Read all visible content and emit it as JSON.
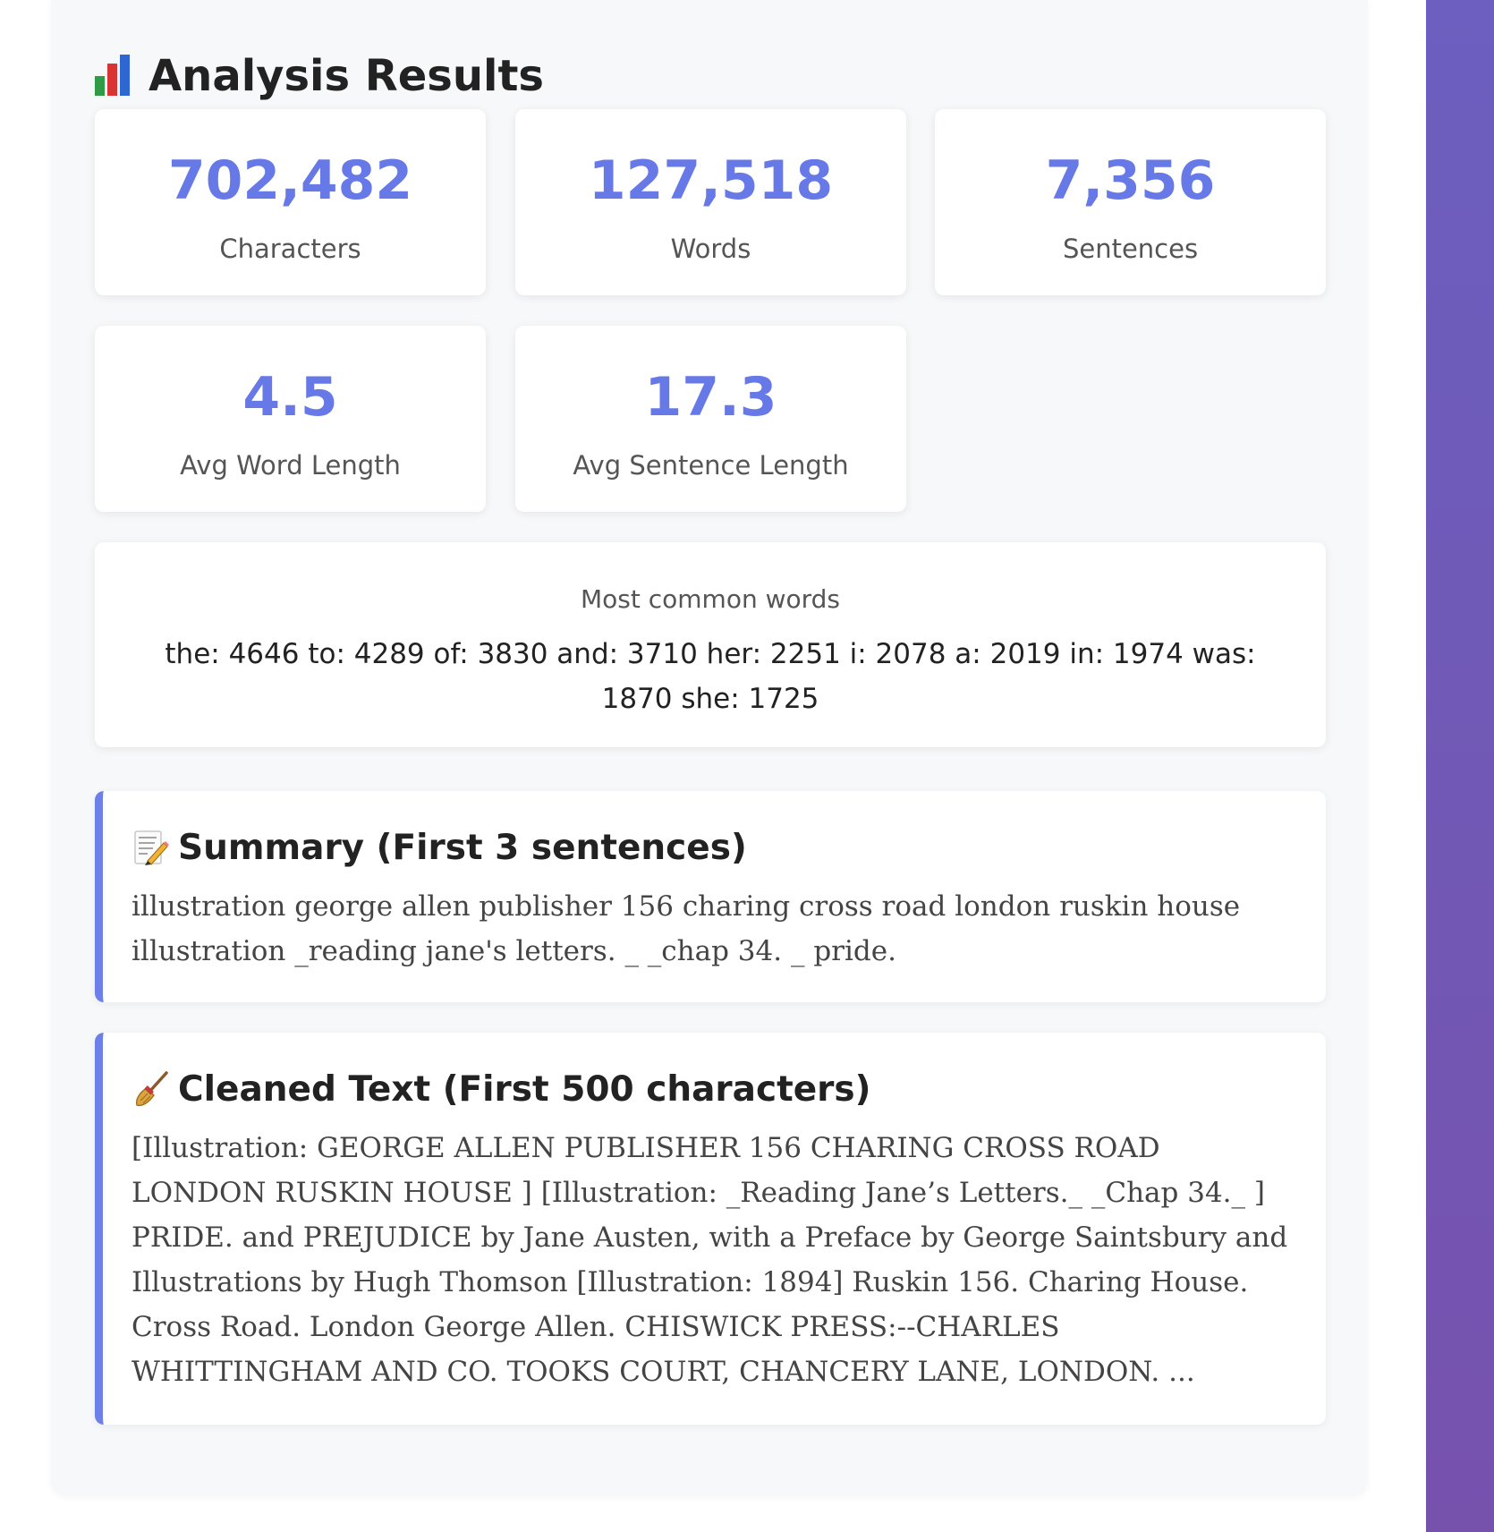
{
  "heading": {
    "icon": "bar-chart-icon",
    "title": "Analysis Results"
  },
  "stats": [
    {
      "value": "702,482",
      "label": "Characters"
    },
    {
      "value": "127,518",
      "label": "Words"
    },
    {
      "value": "7,356",
      "label": "Sentences"
    },
    {
      "value": "4.5",
      "label": "Avg Word Length"
    },
    {
      "value": "17.3",
      "label": "Avg Sentence Length"
    }
  ],
  "common_words": {
    "title": "Most common words",
    "text": "the: 4646 to: 4289 of: 3830 and: 3710 her: 2251 i: 2078 a: 2019 in: 1974 was: 1870 she: 1725"
  },
  "summary": {
    "icon": "memo-icon",
    "title": "Summary (First 3 sentences)",
    "text": "illustration george allen publisher 156 charing cross road london ruskin house illustration _reading jane's letters. _ _chap 34. _ pride."
  },
  "cleaned": {
    "icon": "broom-icon",
    "title": "Cleaned Text (First 500 characters)",
    "text": "[Illustration:  GEORGE ALLEN PUBLISHER  156 CHARING CROSS ROAD LONDON RUSKIN HOUSE ]  [Illustration:  _Reading Jane’s Letters._ _Chap 34._ ]     PRIDE. and PREJUDICE  by Jane Austen,  with a Preface by George Saintsbury and Illustrations by Hugh Thomson  [Illustration: 1894]  Ruskin 156. Charing House. Cross Road.  London George Allen.     CHISWICK PRESS:--CHARLES WHITTINGHAM AND CO. TOOKS COURT, CHANCERY LANE, LONDON.   ..."
  },
  "colors": {
    "accent": "#6779e6",
    "sidebar_gradient_top": "#6c5fbf",
    "sidebar_gradient_bottom": "#7652ad"
  }
}
